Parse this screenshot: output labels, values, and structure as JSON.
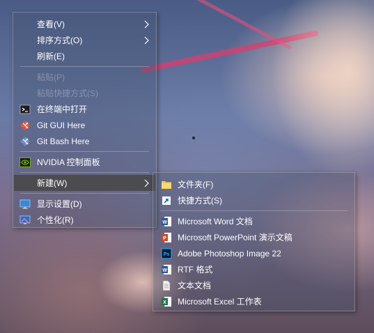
{
  "colors": {
    "menu_bg": "#46506a",
    "hover": "#464646",
    "text": "#ffffff",
    "disabled": "#c8c8d2"
  },
  "context_menu": {
    "items": [
      {
        "label": "查看(V)",
        "has_submenu": true
      },
      {
        "label": "排序方式(O)",
        "has_submenu": true
      },
      {
        "label": "刷新(E)"
      },
      {
        "label": "粘贴(P)",
        "disabled": true
      },
      {
        "label": "粘贴快捷方式(S)",
        "disabled": true
      },
      {
        "label": "在终端中打开",
        "icon": "terminal-icon"
      },
      {
        "label": "Git GUI Here",
        "icon": "git-gui-icon"
      },
      {
        "label": "Git Bash Here",
        "icon": "git-bash-icon"
      },
      {
        "label": "NVIDIA 控制面板",
        "icon": "nvidia-icon"
      },
      {
        "label": "新建(W)",
        "has_submenu": true,
        "highlighted": true
      },
      {
        "label": "显示设置(D)",
        "icon": "display-icon"
      },
      {
        "label": "个性化(R)",
        "icon": "personalize-icon"
      }
    ]
  },
  "new_submenu": {
    "items": [
      {
        "label": "文件夹(F)",
        "icon": "folder-icon"
      },
      {
        "label": "快捷方式(S)",
        "icon": "shortcut-icon"
      },
      {
        "label": "Microsoft Word 文档",
        "icon": "word-icon"
      },
      {
        "label": "Microsoft PowerPoint 演示文稿",
        "icon": "powerpoint-icon"
      },
      {
        "label": "Adobe Photoshop Image 22",
        "icon": "photoshop-icon"
      },
      {
        "label": "RTF 格式",
        "icon": "rtf-icon"
      },
      {
        "label": "文本文档",
        "icon": "text-document-icon"
      },
      {
        "label": "Microsoft Excel 工作表",
        "icon": "excel-icon"
      }
    ]
  }
}
